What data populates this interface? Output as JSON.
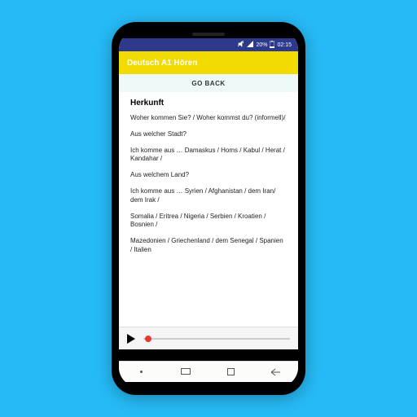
{
  "status": {
    "battery_pct": "20%",
    "time": "02:15",
    "signal_icon": "signal-icon",
    "mute_icon": "mute-icon"
  },
  "app": {
    "title": "Deutsch A1 Hören"
  },
  "nav": {
    "back_label": "GO BACK"
  },
  "content": {
    "heading": "Herkunft",
    "paragraphs": [
      "Woher kommen Sie? / Woher kommst du? (informell)/",
      "Aus welcher Stadt?",
      "Ich komme aus … Damaskus / Homs / Kabul / Herat / Kandahar /",
      "Aus welchem Land?",
      "Ich komme aus … Syrien / Afghanistan / dem Iran/ dem Irak /",
      "Somalia / Eritrea / Nigeria / Serbien / Kroatien / Bosnien /",
      "Mazedonien / Griechenland / dem Senegal / Spanien / Italien"
    ]
  },
  "player": {
    "progress_pct": 2
  }
}
